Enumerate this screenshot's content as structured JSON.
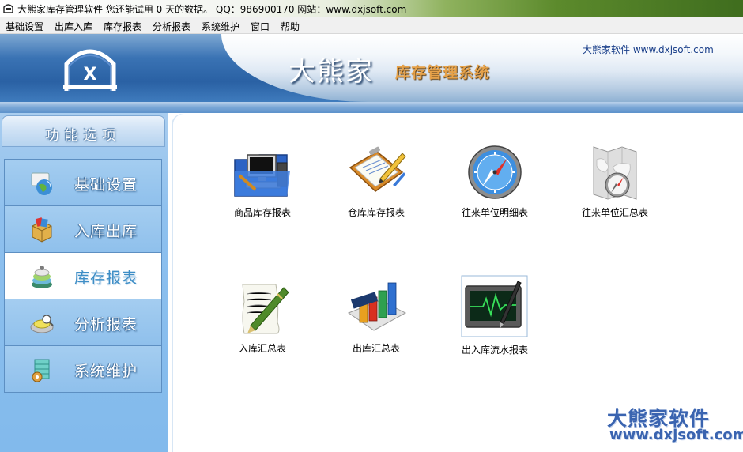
{
  "window": {
    "title": "大熊家库存管理软件   您还能试用 0 天的数据。     QQ：986900170 网站：www.dxjsoft.com"
  },
  "menu": [
    "基础设置",
    "出库入库",
    "库存报表",
    "分析报表",
    "系统维护",
    "窗口",
    "帮助"
  ],
  "banner": {
    "brand": "大熊家",
    "subtitle": "库存管理系统",
    "site": "大熊家软件  www.dxjsoft.com"
  },
  "sidebar": {
    "header": "功能选项",
    "items": [
      {
        "label": "基础设置",
        "icon": "globe-settings-icon"
      },
      {
        "label": "入库出库",
        "icon": "box-icon"
      },
      {
        "label": "库存报表",
        "icon": "stack-icon",
        "active": true
      },
      {
        "label": "分析报表",
        "icon": "analysis-icon"
      },
      {
        "label": "系统维护",
        "icon": "maintenance-icon"
      }
    ]
  },
  "reports": [
    {
      "label": "商品库存报表",
      "icon": "computer-folder-icon"
    },
    {
      "label": "仓库库存报表",
      "icon": "clipboard-pencil-icon"
    },
    {
      "label": "往来单位明细表",
      "icon": "compass-icon"
    },
    {
      "label": "往来单位汇总表",
      "icon": "map-compass-icon"
    },
    {
      "label": "入库汇总表",
      "icon": "document-pen-icon"
    },
    {
      "label": "出库汇总表",
      "icon": "bar-chart-icon"
    },
    {
      "label": "出入库流水报表",
      "icon": "monitor-pen-icon"
    }
  ],
  "watermark": {
    "line1": "大熊家软件",
    "line2": "www.dxjsoft.com"
  },
  "colors": {
    "banner_blue": "#2a61a4",
    "sidebar_blue": "#8ec0ee",
    "active_label": "#3e8ec6",
    "watermark": "#3a64b0"
  }
}
